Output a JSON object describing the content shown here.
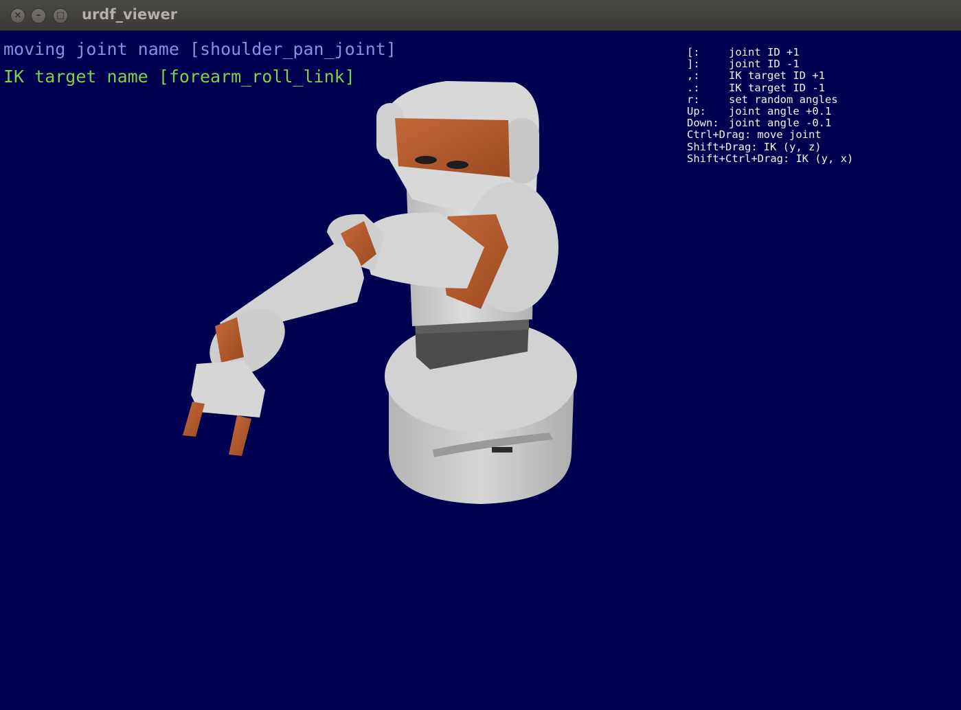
{
  "window": {
    "title": "urdf_viewer",
    "buttons": {
      "close": "×",
      "minimize": "–",
      "maximize": "□"
    }
  },
  "status": {
    "moving_joint": "moving joint name [shoulder_pan_joint]",
    "ik_target": "IK target name [forearm_roll_link]"
  },
  "help": [
    {
      "key": "[:",
      "action": "joint ID +1"
    },
    {
      "key": "]:",
      "action": "joint ID -1"
    },
    {
      "key": ",:",
      "action": "IK target ID +1"
    },
    {
      "key": ".:",
      "action": "IK target ID -1"
    },
    {
      "key": "r:",
      "action": "set random angles"
    },
    {
      "key": "Up:",
      "action": "joint angle +0.1"
    },
    {
      "key": "Down:",
      "action": "joint angle -0.1"
    },
    {
      "key": "Ctrl+Drag:",
      "action": "move joint"
    },
    {
      "key": "Shift+Drag:",
      "action": "IK (y, z)"
    },
    {
      "key": "Shift+Ctrl+Drag:",
      "action": "IK (y, x)"
    }
  ],
  "colors": {
    "background": "#000050",
    "robot_body": "#c9c9c9",
    "robot_accent": "#b45a2a",
    "joint_text": "#8c8ce8",
    "ik_text": "#7ed14b"
  }
}
